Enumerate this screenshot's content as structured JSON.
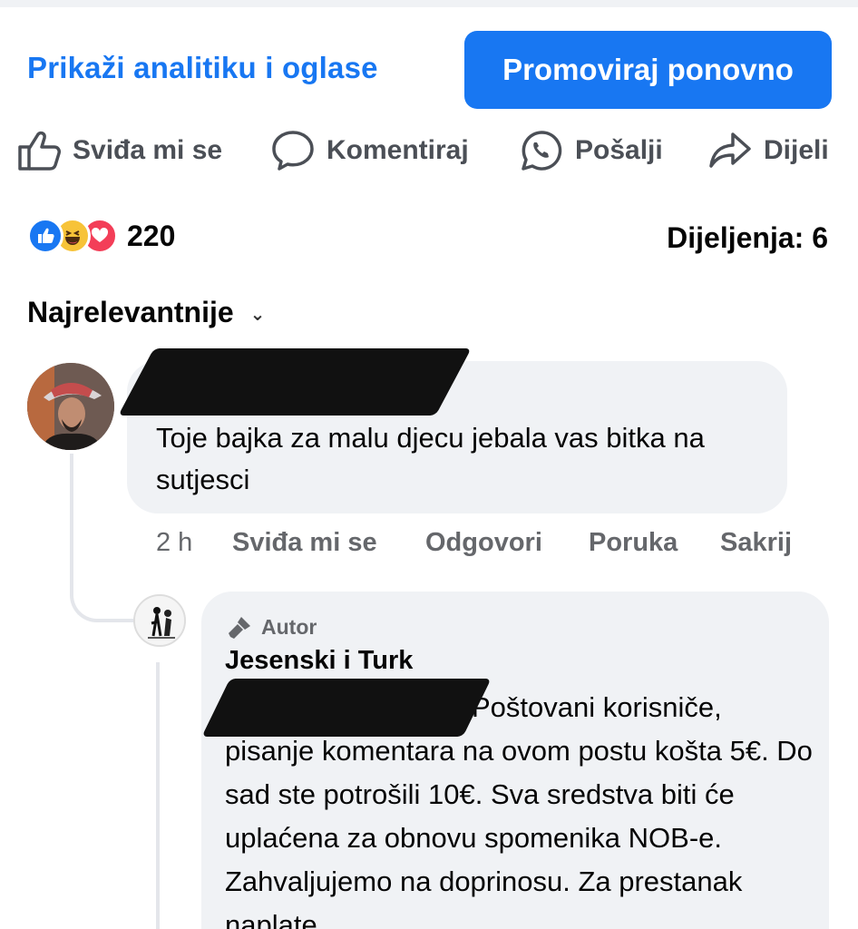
{
  "header": {
    "analytics_link": "Prikaži analitiku i oglase",
    "promote_button": "Promoviraj ponovno"
  },
  "actions": {
    "like": "Sviđa mi se",
    "comment": "Komentiraj",
    "send": "Pošalji",
    "share": "Dijeli"
  },
  "reactions": {
    "icons": [
      "like-icon",
      "haha-icon",
      "love-icon"
    ],
    "count": "220",
    "shares": "Dijeljenja: 6"
  },
  "sort": {
    "label": "Najrelevantnije"
  },
  "comments": [
    {
      "text": "Toje bajka za malu djecu jebala vas bitka na sutjesci",
      "time": "2 h",
      "like": "Sviđa mi se",
      "reply": "Odgovori",
      "message": "Poruka",
      "hide": "Sakrij"
    },
    {
      "badge": "Autor",
      "author": "Jesenski i Turk",
      "text": "Poštovani korisniče, pisanje komentara na ovom postu košta 5€. Do sad ste potrošili 10€. Sva sredstva biti će uplaćena za obnovu spomenika NOB-e. Zahvaljujemo na doprinosu. Za prestanak naplate"
    }
  ],
  "colors": {
    "brand_blue": "#1877f2",
    "bubble_bg": "#f0f2f5",
    "muted_text": "#65676b"
  }
}
